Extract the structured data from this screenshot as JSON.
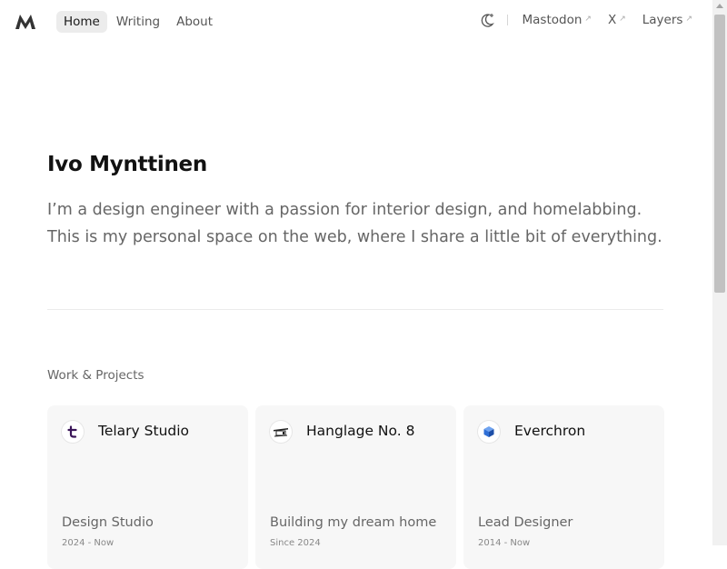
{
  "nav": {
    "links": [
      {
        "label": "Home",
        "active": true
      },
      {
        "label": "Writing",
        "active": false
      },
      {
        "label": "About",
        "active": false
      }
    ],
    "theme_icon": "moon-sparkle-icon",
    "external": [
      {
        "label": "Mastodon",
        "icon": "arrow-up-right-icon"
      },
      {
        "label": "X",
        "icon": "arrow-up-right-icon"
      },
      {
        "label": "Layers",
        "icon": "arrow-up-right-icon"
      }
    ]
  },
  "hero": {
    "name": "Ivo Mynttinen",
    "bio": "I’m a design engineer with a passion for interior design, and homelabbing. This is my personal space on the web, where I share a little bit of everything."
  },
  "projects": {
    "title": "Work & Projects",
    "items": [
      {
        "name": "Telary Studio",
        "role": "Design Studio",
        "date": "2024 - Now",
        "icon": "telary-logo-icon",
        "icon_color": "#3a1558"
      },
      {
        "name": "Hanglage No. 8",
        "role": "Building my dream home",
        "date": "Since 2024",
        "icon": "house-icon",
        "icon_color": "#222222"
      },
      {
        "name": "Everchron",
        "role": "Lead Designer",
        "date": "2014 - Now",
        "icon": "cube-icon",
        "icon_color": "#2f6fd6"
      }
    ]
  },
  "colors": {
    "text": "#111111",
    "muted": "#666666",
    "card_bg": "#f7f7f7",
    "nav_active_bg": "#ececec"
  }
}
